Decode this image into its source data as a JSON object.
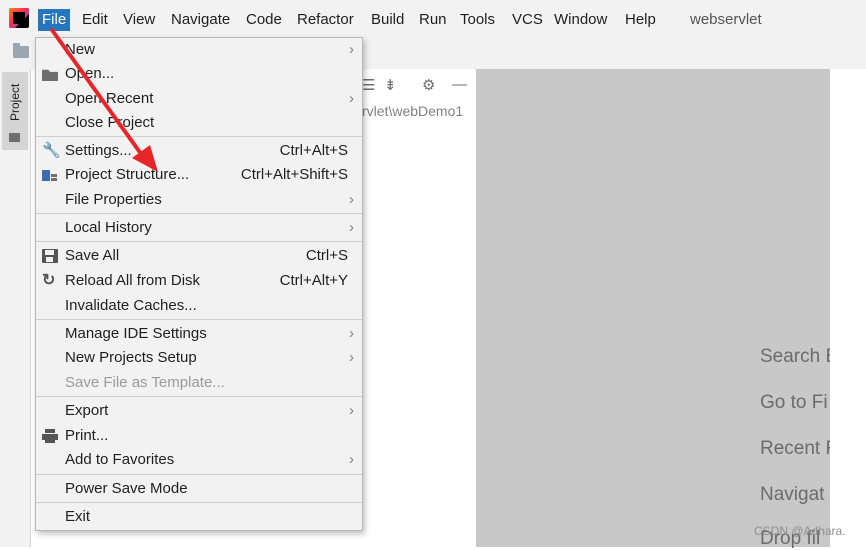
{
  "menubar": {
    "items": [
      {
        "label": "File",
        "underline": "F"
      },
      {
        "label": "Edit",
        "underline": "E"
      },
      {
        "label": "View",
        "underline": "V"
      },
      {
        "label": "Navigate",
        "underline": "N"
      },
      {
        "label": "Code",
        "underline": "C"
      },
      {
        "label": "Refactor",
        "underline": "R"
      },
      {
        "label": "Build",
        "underline": "B"
      },
      {
        "label": "Run",
        "underline": "u"
      },
      {
        "label": "Tools",
        "underline": "T"
      },
      {
        "label": "VCS",
        "underline": "S"
      },
      {
        "label": "Window",
        "underline": "W"
      },
      {
        "label": "Help",
        "underline": "H"
      }
    ],
    "project_name": "webservlet",
    "active_color": "#2675bf"
  },
  "sidebar": {
    "project_tab": "Project"
  },
  "panel": {
    "breadcrumb": "rvlet\\webDemo1"
  },
  "file_menu": {
    "items": [
      {
        "label": "New",
        "shortcut": "",
        "submenu": true
      },
      {
        "label": "Open...",
        "shortcut": "",
        "submenu": false,
        "icon": "folder-open-icon"
      },
      {
        "label": "Open Recent",
        "shortcut": "",
        "submenu": true
      },
      {
        "label": "Close Project",
        "shortcut": "",
        "submenu": false
      },
      {
        "label": "Settings...",
        "shortcut": "Ctrl+Alt+S",
        "submenu": false,
        "icon": "wrench-icon"
      },
      {
        "label": "Project Structure...",
        "shortcut": "Ctrl+Alt+Shift+S",
        "submenu": false,
        "icon": "project-structure-icon"
      },
      {
        "label": "File Properties",
        "shortcut": "",
        "submenu": true
      },
      {
        "label": "Local History",
        "shortcut": "",
        "submenu": true
      },
      {
        "label": "Save All",
        "shortcut": "Ctrl+S",
        "submenu": false,
        "icon": "save-icon"
      },
      {
        "label": "Reload All from Disk",
        "shortcut": "Ctrl+Alt+Y",
        "submenu": false,
        "icon": "reload-icon"
      },
      {
        "label": "Invalidate Caches...",
        "shortcut": "",
        "submenu": false
      },
      {
        "label": "Manage IDE Settings",
        "shortcut": "",
        "submenu": true
      },
      {
        "label": "New Projects Setup",
        "shortcut": "",
        "submenu": true
      },
      {
        "label": "Save File as Template...",
        "shortcut": "",
        "submenu": false,
        "disabled": true
      },
      {
        "label": "Export",
        "shortcut": "",
        "submenu": true
      },
      {
        "label": "Print...",
        "shortcut": "",
        "submenu": false,
        "icon": "print-icon"
      },
      {
        "label": "Add to Favorites",
        "shortcut": "",
        "submenu": true
      },
      {
        "label": "Power Save Mode",
        "shortcut": "",
        "submenu": false
      },
      {
        "label": "Exit",
        "shortcut": "",
        "submenu": false
      }
    ],
    "submenu_arrow": "›"
  },
  "editor": {
    "hints": [
      "Search E",
      "Go to Fi",
      "Recent F",
      "Navigat",
      "Drop fil"
    ]
  },
  "watermark": "CSDN @Adhara.",
  "annotation": {
    "color": "#e8262a"
  }
}
